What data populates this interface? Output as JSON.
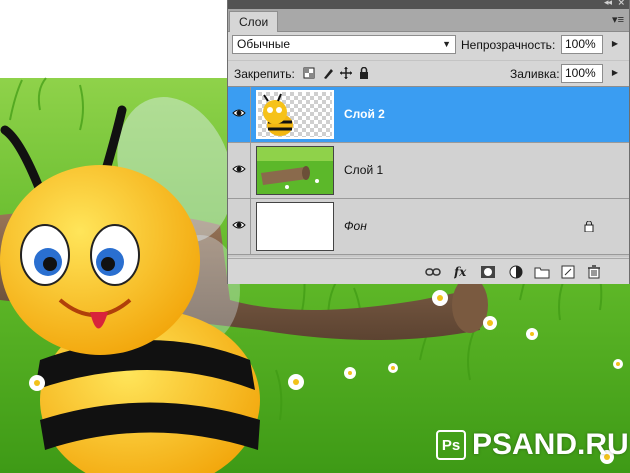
{
  "panel": {
    "tab_label": "Слои",
    "blend_mode": "Обычные",
    "opacity_label": "Непрозрачность:",
    "opacity_value": "100%",
    "lock_label": "Закрепить:",
    "fill_label": "Заливка:",
    "fill_value": "100%",
    "layers": [
      {
        "name": "Слой 2",
        "selected": true,
        "visible": true
      },
      {
        "name": "Слой 1",
        "selected": false,
        "visible": true
      },
      {
        "name": "Фон",
        "selected": false,
        "visible": true,
        "locked": true
      }
    ],
    "lock_icons": [
      "lock-transparent-icon",
      "lock-image-icon",
      "lock-position-icon",
      "lock-all-icon"
    ],
    "bottom_icons": [
      "link-icon",
      "fx-icon",
      "mask-icon",
      "adjustment-icon",
      "folder-icon",
      "new-layer-icon",
      "trash-icon"
    ]
  },
  "watermark": {
    "badge": "Ps",
    "text": "PSAND.RU"
  },
  "colors": {
    "selection": "#3a9df2",
    "panel_bg": "#d6d6d6",
    "titlebar": "#535353"
  }
}
